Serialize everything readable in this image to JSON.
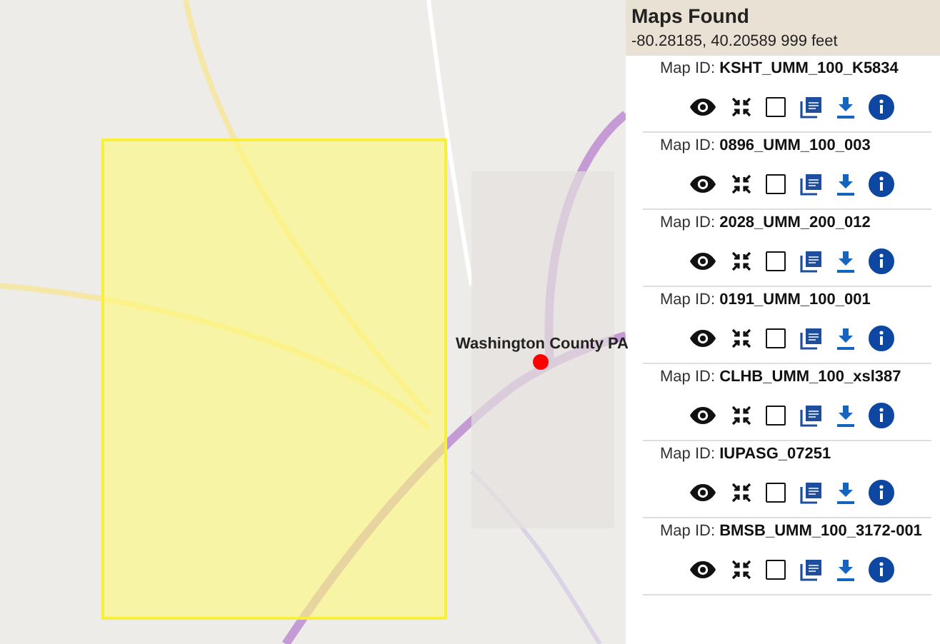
{
  "map": {
    "marker": {
      "label": "Washington County PA"
    }
  },
  "panel": {
    "title": "Maps Found",
    "coordinates": "-80.28185, 40.20589 999 feet",
    "maps": [
      {
        "label": "Map ID:",
        "id": "KSHT_UMM_100_K5834",
        "checked": false
      },
      {
        "label": "Map ID:",
        "id": "0896_UMM_100_003",
        "checked": false
      },
      {
        "label": "Map ID:",
        "id": "2028_UMM_200_012",
        "checked": false
      },
      {
        "label": "Map ID:",
        "id": "0191_UMM_100_001",
        "checked": false
      },
      {
        "label": "Map ID:",
        "id": "CLHB_UMM_100_xsl387",
        "checked": false
      },
      {
        "label": "Map ID:",
        "id": "IUPASG_07251",
        "checked": false
      },
      {
        "label": "Map ID:",
        "id": "BMSB_UMM_100_3172-001",
        "checked": false
      }
    ]
  }
}
